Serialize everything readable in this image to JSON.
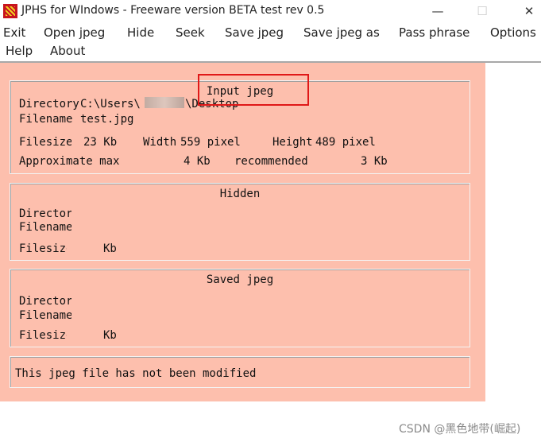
{
  "window": {
    "title": "JPHS for WIndows - Freeware version BETA test rev 0.5",
    "min_symbol": "—",
    "max_symbol": "☐",
    "close_symbol": "✕",
    "icon": "jphs-app-icon"
  },
  "menu": [
    "Exit",
    "Open jpeg",
    "Hide",
    "Seek",
    "Save jpeg",
    "Save jpeg as",
    "Pass phrase",
    "Options",
    "Help",
    "About"
  ],
  "input_jpeg": {
    "title": "Input jpeg",
    "directory_label": "Directory",
    "directory_value": "C:\\Users\\",
    "directory_suffix": "\\Desktop",
    "filename_label": "Filename",
    "filename_value": "test.jpg",
    "filesize_label": "Filesize",
    "filesize_value": "23 Kb",
    "width_label": "Width",
    "width_value": "559 pixel",
    "height_label": "Height",
    "height_value": "489 pixel",
    "approx_label": "Approximate max",
    "approx_value": "4 Kb",
    "recommended_label": "recommended",
    "recommended_value": "3 Kb"
  },
  "hidden": {
    "title": "Hidden",
    "directory_label": "Directory",
    "filename_label": "Filename",
    "filesize_label": "Filesize",
    "filesize_unit": "Kb"
  },
  "saved_jpeg": {
    "title": "Saved jpeg",
    "directory_label": "Directory",
    "filename_label": "Filename",
    "filesize_label": "Filesize",
    "filesize_unit": "Kb"
  },
  "status": {
    "message": "This jpeg file has not been modified"
  },
  "watermark": "CSDN @黑色地带(崛起)",
  "colors": {
    "client_background": "#fdbfad",
    "highlight_border": "#e01818"
  }
}
